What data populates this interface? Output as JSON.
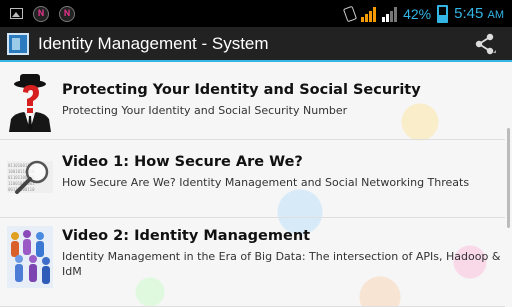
{
  "status_bar": {
    "battery_percent": "42%",
    "time": "5:45",
    "am_pm": "AM",
    "notification_badge_1": "N",
    "notification_badge_2": "N",
    "accent_color": "#33b5e5"
  },
  "action_bar": {
    "title": "Identity Management - System",
    "share_icon": "share-icon",
    "app_icon": "app-icon"
  },
  "list": {
    "items": [
      {
        "title": "Protecting Your Identity and Social Security",
        "subtitle": "Protecting Your Identity and Social Security Number",
        "thumbnail": "question-mark-man-icon"
      },
      {
        "title": "Video 1: How Secure Are We?",
        "subtitle": "How Secure Are We? Identity Management and Social Networking Threats",
        "thumbnail": "magnifying-glass-icon"
      },
      {
        "title": "Video 2: Identity Management",
        "subtitle": "Identity Management in the Era of Big Data: The intersection of APIs, Hadoop & IdM",
        "thumbnail": "people-group-icon"
      }
    ]
  }
}
